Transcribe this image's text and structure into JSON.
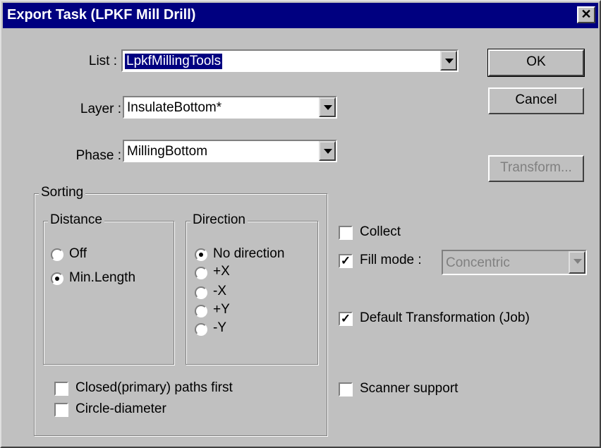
{
  "window": {
    "title": "Export Task (LPKF Mill Drill)",
    "close_glyph": "✕"
  },
  "fields": {
    "list": {
      "label": "List :",
      "value": "LpkfMillingTools"
    },
    "layer": {
      "label": "Layer :",
      "value": "InsulateBottom*"
    },
    "phase": {
      "label": "Phase :",
      "value": "MillingBottom"
    }
  },
  "buttons": {
    "ok": "OK",
    "cancel": "Cancel",
    "transform": "Transform..."
  },
  "sorting": {
    "label": "Sorting",
    "distance": {
      "label": "Distance",
      "options": [
        "Off",
        "Min.Length"
      ],
      "selected": "Min.Length"
    },
    "direction": {
      "label": "Direction",
      "options": [
        "No direction",
        "+X",
        "-X",
        "+Y",
        "-Y"
      ],
      "selected": "No direction"
    },
    "closed_first": {
      "label": "Closed(primary) paths first",
      "checked": false
    },
    "circle_diameter": {
      "label": "Circle-diameter",
      "checked": false
    }
  },
  "options": {
    "collect": {
      "label": "Collect",
      "checked": false
    },
    "fill_mode": {
      "label": "Fill mode :",
      "checked": true,
      "value": "Concentric"
    },
    "default_transformation": {
      "label": "Default Transformation (Job)",
      "checked": true
    },
    "scanner_support": {
      "label": "Scanner support",
      "checked": false
    }
  },
  "check_glyph": "✓",
  "colors": {
    "titlebar": "#000080",
    "face": "#c0c0c0"
  }
}
